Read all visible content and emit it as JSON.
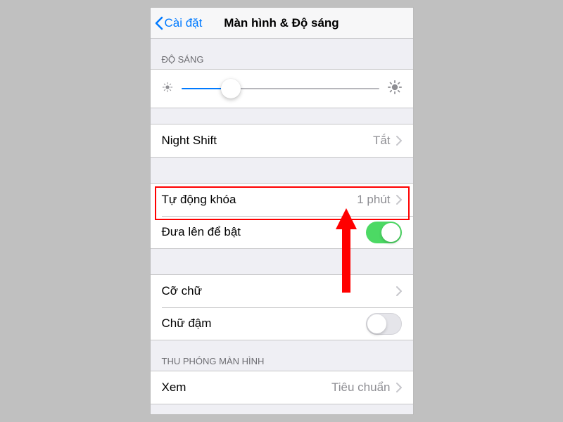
{
  "nav": {
    "back": "Cài đặt",
    "title": "Màn hình & Độ sáng"
  },
  "sections": {
    "brightness_header": "ĐỘ SÁNG",
    "zoom_header": "THU PHÓNG MÀN HÌNH"
  },
  "rows": {
    "night_shift": {
      "label": "Night Shift",
      "value": "Tắt"
    },
    "auto_lock": {
      "label": "Tự động khóa",
      "value": "1 phút"
    },
    "raise_to_wake": {
      "label": "Đưa lên để bật"
    },
    "text_size": {
      "label": "Cỡ chữ"
    },
    "bold_text": {
      "label": "Chữ đậm"
    },
    "view": {
      "label": "Xem",
      "value": "Tiêu chuẩn"
    }
  },
  "slider": {
    "percent": 25
  },
  "toggles": {
    "raise_to_wake": true,
    "bold_text": false
  }
}
